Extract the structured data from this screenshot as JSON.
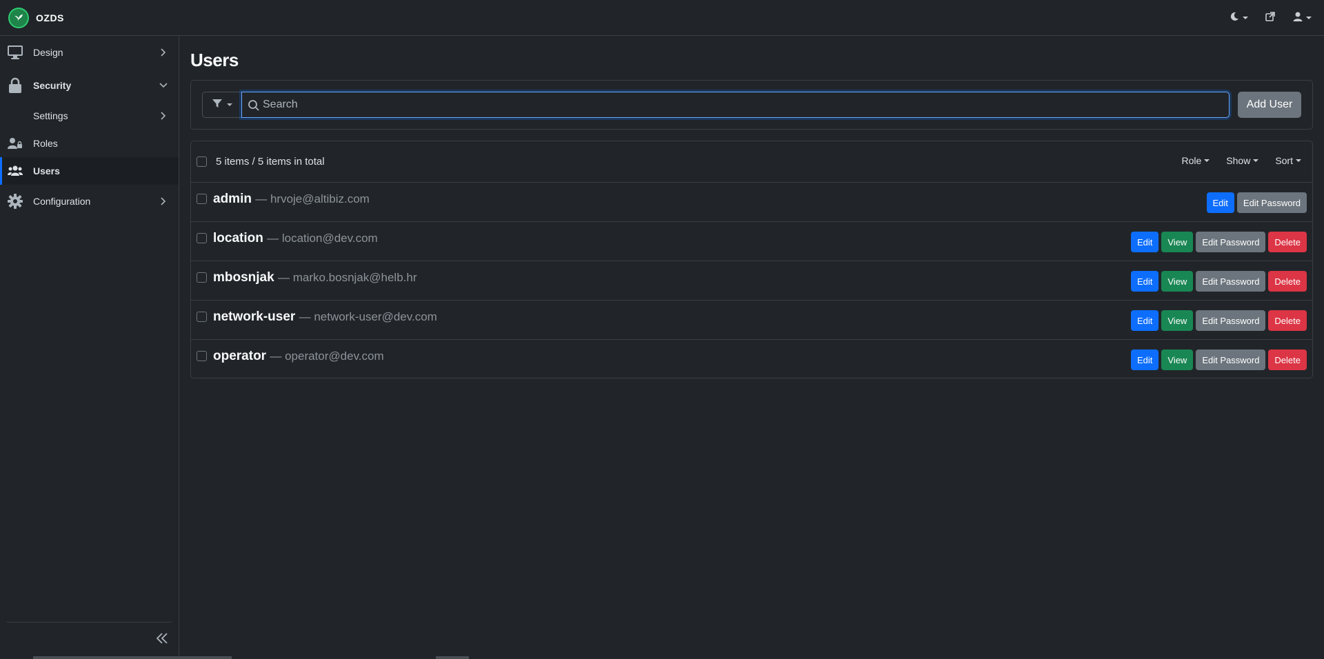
{
  "brand": {
    "name": "OZDS"
  },
  "icons": {
    "brand": "leaf-logo-icon",
    "theme": "moon-icon",
    "external": "external-link-icon",
    "user": "user-icon",
    "filter": "filter-icon",
    "search": "search-icon",
    "collapse": "double-chevron-left-icon"
  },
  "colors": {
    "background": "#212529",
    "accent": "#0d6efd",
    "success": "#198754",
    "secondary": "#6c757d",
    "danger": "#dc3545",
    "brand_green": "#2ecc71"
  },
  "sidebar": {
    "items": [
      {
        "label": "Design",
        "icon": "monitor-icon",
        "chevron": "right"
      },
      {
        "label": "Security",
        "icon": "lock-icon",
        "chevron": "down"
      },
      {
        "label": "Settings",
        "icon": "",
        "chevron": "right"
      },
      {
        "label": "Roles",
        "icon": "user-lock-icon"
      },
      {
        "label": "Users",
        "icon": "users-icon",
        "active": true
      },
      {
        "label": "Configuration",
        "icon": "gear-icon",
        "chevron": "right"
      }
    ]
  },
  "page": {
    "title": "Users"
  },
  "search": {
    "placeholder": "Search",
    "value": "",
    "add_label": "Add User"
  },
  "list": {
    "count_text": "5 items / 5 items in total",
    "header_controls": [
      "Role",
      "Show",
      "Sort"
    ],
    "rows": [
      {
        "name": "admin",
        "email": "— hrvoje@altibiz.com",
        "actions": [
          "Edit",
          "Edit Password"
        ]
      },
      {
        "name": "location",
        "email": "— location@dev.com",
        "actions": [
          "Edit",
          "View",
          "Edit Password",
          "Delete"
        ]
      },
      {
        "name": "mbosnjak",
        "email": "— marko.bosnjak@helb.hr",
        "actions": [
          "Edit",
          "View",
          "Edit Password",
          "Delete"
        ]
      },
      {
        "name": "network-user",
        "email": "— network-user@dev.com",
        "actions": [
          "Edit",
          "View",
          "Edit Password",
          "Delete"
        ]
      },
      {
        "name": "operator",
        "email": "— operator@dev.com",
        "actions": [
          "Edit",
          "View",
          "Edit Password",
          "Delete"
        ]
      }
    ]
  }
}
